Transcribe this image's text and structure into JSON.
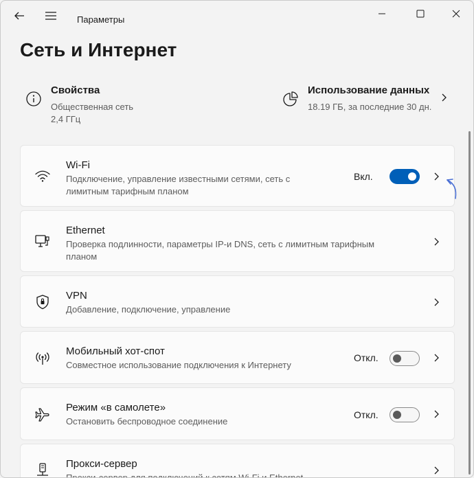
{
  "window": {
    "app_title": "Параметры",
    "page_title": "Сеть и Интернет"
  },
  "summary": {
    "properties": {
      "title": "Свойства",
      "line1": "Общественная сеть",
      "line2": "2,4 ГГц",
      "icon": "info-icon"
    },
    "data_usage": {
      "title": "Использование данных",
      "line1": "18.19 ГБ, за последние 30 дн.",
      "icon": "pie-chart-icon"
    }
  },
  "cards": {
    "wifi": {
      "title": "Wi-Fi",
      "desc": "Подключение, управление известными сетями, сеть с лимитным тарифным планом",
      "state": "Вкл.",
      "toggle_on": true,
      "icon": "wifi-icon"
    },
    "ethernet": {
      "title": "Ethernet",
      "desc": "Проверка подлинности, параметры IP-и DNS, сеть с лимитным тарифным планом",
      "icon": "ethernet-icon"
    },
    "vpn": {
      "title": "VPN",
      "desc": "Добавление, подключение, управление",
      "icon": "shield-icon"
    },
    "hotspot": {
      "title": "Мобильный хот-спот",
      "desc": "Совместное использование подключения к Интернету",
      "state": "Откл.",
      "toggle_on": false,
      "icon": "hotspot-icon"
    },
    "airplane": {
      "title": "Режим «в самолете»",
      "desc": "Остановить беспроводное соединение",
      "state": "Откл.",
      "toggle_on": false,
      "icon": "airplane-icon"
    },
    "proxy": {
      "title": "Прокси-сервер",
      "desc": "Прокси-сервер для подключений к сетям Wi-Fi и Ethernet",
      "icon": "proxy-icon"
    }
  },
  "colors": {
    "accent": "#005fb8",
    "annotation": "#4a6fd4",
    "background": "#f3f3f3",
    "card": "#fbfbfb"
  }
}
